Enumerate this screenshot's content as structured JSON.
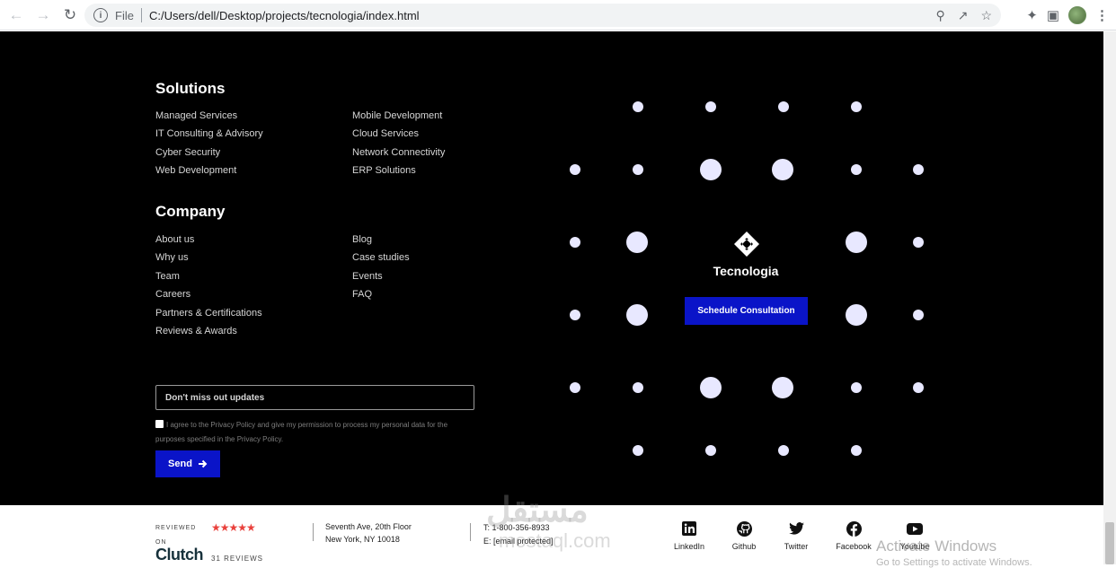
{
  "browser": {
    "file_label": "File",
    "url": "C:/Users/dell/Desktop/projects/tecnologia/index.html"
  },
  "solutions": {
    "title": "Solutions",
    "col1": [
      "Managed Services",
      "IT Consulting & Advisory",
      "Cyber Security",
      "Web Development"
    ],
    "col2": [
      "Mobile Development",
      "Cloud Services",
      "Network Connectivity",
      "ERP Solutions"
    ]
  },
  "company": {
    "title": "Company",
    "col1": [
      "About us",
      "Why us",
      "Team",
      "Careers",
      "Partners & Certifications",
      "Reviews & Awards"
    ],
    "col2": [
      "Blog",
      "Case studies",
      "Events",
      "FAQ"
    ]
  },
  "newsletter": {
    "placeholder": "Don't miss out updates",
    "agree_text": "I agree to the Privacy Policy and give my permission to process my personal data for the purposes specified in the Privacy Policy.",
    "send_label": "Send"
  },
  "brand": {
    "name": "Tecnologia",
    "cta_label": "Schedule Consultation"
  },
  "review": {
    "reviewed_label": "REVIEWED",
    "on_label": "ON",
    "stars": "★★★★★",
    "platform": "Clutch",
    "count_label": "31 REVIEWS"
  },
  "address": {
    "line1": "Seventh Ave, 20th Floor",
    "line2": "New York, NY 10018"
  },
  "contact": {
    "phone": "T: 1-800-356-8933",
    "email": "E: [email protected]"
  },
  "social": [
    "LinkedIn",
    "Github",
    "Twitter",
    "Facebook",
    "Youtube"
  ],
  "overlays": {
    "watermark_ar": "مستقل",
    "watermark_domain": "mostaql.com",
    "activate_title": "Activate Windows",
    "activate_sub": "Go to Settings to activate Windows."
  },
  "colors": {
    "accent": "#0a14c8",
    "background": "#000000",
    "dot": "#e8e8ff",
    "star": "#e9413c"
  }
}
